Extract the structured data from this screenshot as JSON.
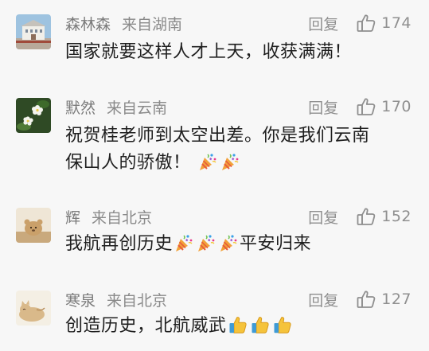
{
  "comments": [
    {
      "user": "森林森",
      "location": "来自湖南",
      "reply_label": "回复",
      "likes": "174",
      "text": "国家就要这样人才上天，收获满满！",
      "emojis": []
    },
    {
      "user": "默然",
      "location": "来自云南",
      "reply_label": "回复",
      "likes": "170",
      "text_line1": "祝贺桂老师到太空出差。你是我们云南",
      "text_line2": "保山人的骄傲！",
      "emojis": [
        "party-popper-icon",
        "party-popper-icon"
      ]
    },
    {
      "user": "辉",
      "location": "来自北京",
      "reply_label": "回复",
      "likes": "152",
      "text_before": "我航再创历史",
      "text_after": "平安归来",
      "emojis": [
        "party-popper-icon",
        "party-popper-icon",
        "party-popper-icon"
      ]
    },
    {
      "user": "寒泉",
      "location": "来自北京",
      "reply_label": "回复",
      "likes": "127",
      "text": "创造历史，北航威武",
      "emojis": [
        "thumbs-up-icon",
        "thumbs-up-icon",
        "thumbs-up-icon"
      ]
    }
  ],
  "colors": {
    "background": "#f7f7f7",
    "meta_text": "#8a8a8a",
    "body_text": "#1f1f1f"
  }
}
